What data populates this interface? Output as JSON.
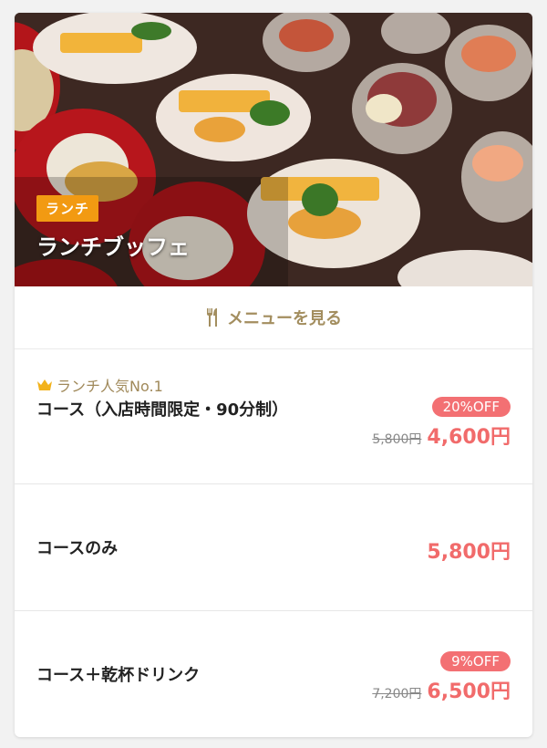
{
  "hero": {
    "badge": "ランチ",
    "title": "ランチブッフェ"
  },
  "menu_link": {
    "label": "メニューを見る",
    "icon": "fork-knife-icon"
  },
  "courses": [
    {
      "tag": "ランチ人気No.1",
      "tag_icon": "crown-icon",
      "name": "コース（入店時間限定・90分制）",
      "discount": "20%OFF",
      "original_price": "5,800円",
      "price": "4,600円"
    },
    {
      "name": "コースのみ",
      "price": "5,800円"
    },
    {
      "name": "コース＋乾杯ドリンク",
      "discount": "9%OFF",
      "original_price": "7,200円",
      "price": "6,500円"
    }
  ],
  "colors": {
    "badge": "#f29a12",
    "accent_gold": "#a38e5f",
    "price_red": "#f16b6b",
    "discount_bg": "#f37073"
  }
}
